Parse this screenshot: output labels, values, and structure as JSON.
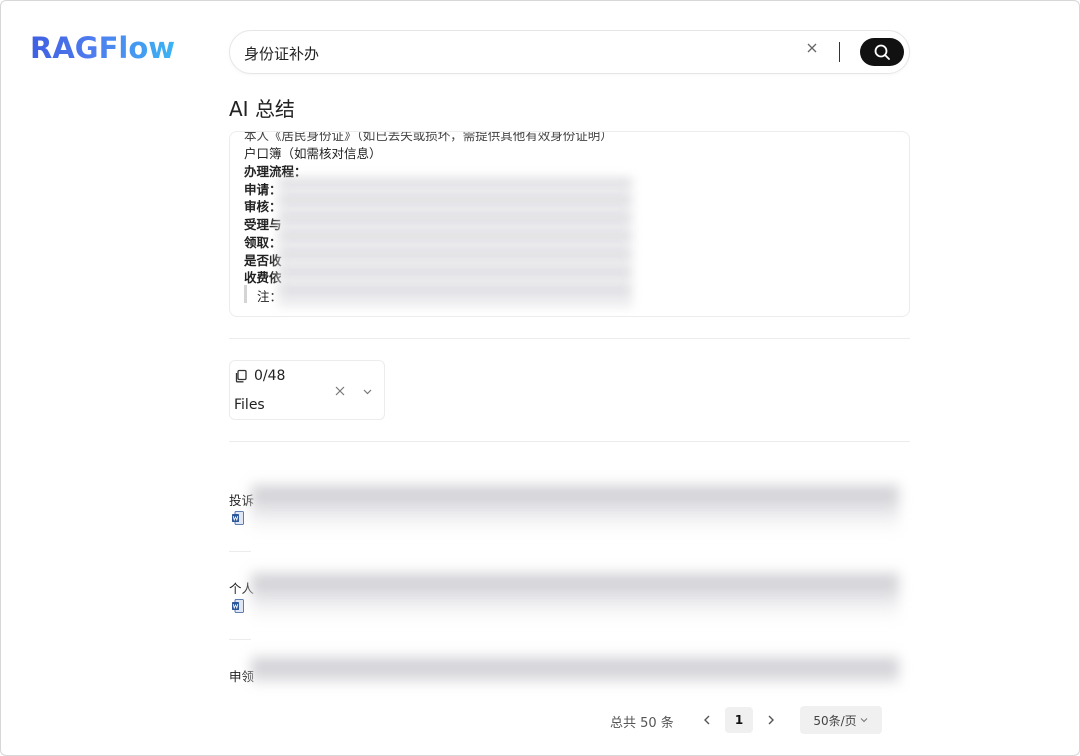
{
  "app": {
    "logo": "RAGFlow"
  },
  "search": {
    "value": "身份证补办",
    "placeholder": ""
  },
  "summary": {
    "title": "AI 总结",
    "cut_line": "本人《居民身份证》（如已丢失或损坏，需提供其他有效身份证明）",
    "lines": [
      {
        "text": "户口簿（如需核对信息）",
        "bold": false
      },
      {
        "text": "办理流程：",
        "bold": true
      },
      {
        "text": "申请：",
        "bold": true
      },
      {
        "text": "审核：",
        "bold": true
      },
      {
        "text": "受理与",
        "bold": true
      },
      {
        "text": "领取：",
        "bold": true
      },
      {
        "text": "是否收",
        "bold": true
      },
      {
        "text": "收费依",
        "bold": true
      }
    ],
    "note": "注："
  },
  "files_filter": {
    "count": "0/48",
    "label": "Files"
  },
  "results": [
    {
      "title_prefix": "投诉"
    },
    {
      "title_prefix": "个人"
    },
    {
      "title_prefix": "申领"
    }
  ],
  "pagination": {
    "total": "总共 50 条",
    "current_page": "1",
    "page_size": "50条/页"
  },
  "colors": {
    "search_button": "#111111",
    "logo_start": "#3f5fe0",
    "logo_end": "#3bb4f2",
    "doc_icon": "#2b579a"
  }
}
